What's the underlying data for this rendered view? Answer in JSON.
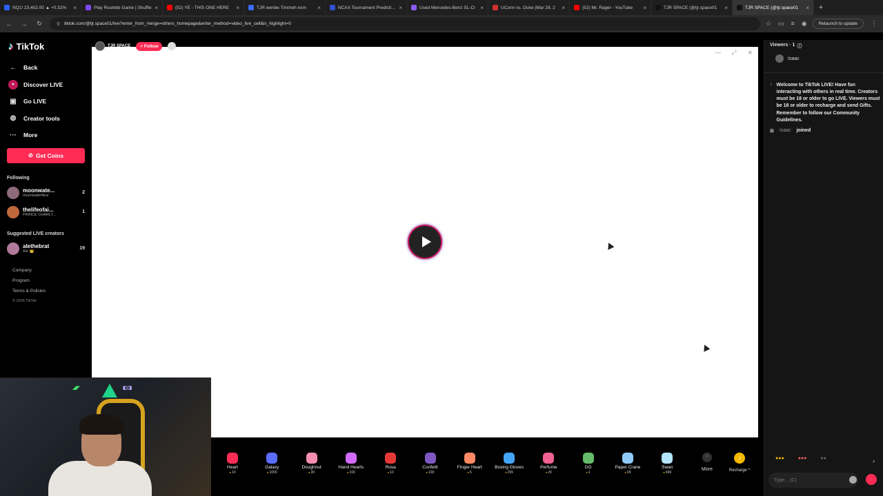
{
  "browser": {
    "tabs": [
      {
        "title": "NQ1! 23,402.00 ▲ +0.32%",
        "color": "#2962ff"
      },
      {
        "title": "Play Roulette Game | Shuffle",
        "color": "#7b4bff"
      },
      {
        "title": "(52) YE - THIS ONE HERE",
        "color": "#ff0000"
      },
      {
        "title": "TJR wenbe Timmeh esm",
        "color": "#3b6bff"
      },
      {
        "title": "NCAA Tournament Prediction",
        "color": "#3050d0"
      },
      {
        "title": "Used Mercedes-Benz SL-Cl",
        "color": "#8b5cf6"
      },
      {
        "title": "UConn vs. Duke (Mar 29, 2",
        "color": "#d32f2f"
      },
      {
        "title": "(52) Mr. Rager - YouTube",
        "color": "#ff0000"
      },
      {
        "title": "TJR SPACE (@tjr.space01",
        "color": "#111111"
      },
      {
        "title": "TJR SPACE (@tjr.space01",
        "color": "#111111"
      }
    ],
    "url": "tiktok.com/@tjr.space01/live?enter_from_merge=others_homepage&enter_method=video_live_cell&is_highlight=0",
    "relaunch": "Relaunch to update"
  },
  "sidebar": {
    "logo": "TikTok",
    "back": "Back",
    "nav": [
      "Discover LIVE",
      "Go LIVE",
      "Creator tools",
      "More"
    ],
    "get_coins": "Get Coins",
    "following_title": "Following",
    "following": [
      {
        "name": "moonwate...",
        "sub": "moonwaterfleur",
        "count": "2",
        "color": "#8e6a7a"
      },
      {
        "name": "thelifeofai...",
        "sub": "PRINCE CHARLT...",
        "count": "1",
        "color": "#c0683c"
      }
    ],
    "suggested_title": "Suggested LIVE creators",
    "suggested": [
      {
        "name": "alethebrat",
        "sub": "Ale 👑",
        "count": "19",
        "color": "#b07a9a"
      }
    ],
    "footer": [
      "Company",
      "Program",
      "Terms & Policies"
    ],
    "copyright": "© 2026 TikTok"
  },
  "stream": {
    "name": "TJR SPACE",
    "follow": "+ Follow"
  },
  "gifts": [
    {
      "name": "Heart",
      "price": "10",
      "color": "#ff2d55"
    },
    {
      "name": "Galaxy",
      "price": "1000",
      "color": "#5b6dff"
    },
    {
      "name": "Doughnut",
      "price": "30",
      "color": "#f48fb1"
    },
    {
      "name": "Hand Hearts",
      "price": "100",
      "color": "#d46bff"
    },
    {
      "name": "Rosa",
      "price": "10",
      "color": "#e53935"
    },
    {
      "name": "Confetti",
      "price": "100",
      "color": "#7e57c2"
    },
    {
      "name": "Finger Heart",
      "price": "5",
      "color": "#ff8a65"
    },
    {
      "name": "Boxing Gloves",
      "price": "299",
      "color": "#42a5f5"
    },
    {
      "name": "Perfume",
      "price": "20",
      "color": "#f06292"
    },
    {
      "name": "GG",
      "price": "1",
      "color": "#66bb6a"
    },
    {
      "name": "Paper Crane",
      "price": "99",
      "color": "#90caf9"
    },
    {
      "name": "Swan",
      "price": "699",
      "color": "#b3e5fc"
    }
  ],
  "gift_more": "More",
  "recharge": "Recharge ^",
  "panel": {
    "viewers": "Viewers · 1",
    "viewer_name": "Isaac",
    "welcome": "Welcome to TikTok LIVE! Have fun interacting with others in real time. Creators must be 18 or older to go LIVE. Viewers must be 18 or older to recharge and send Gifts. Remember to follow our Community Guidelines.",
    "joined_name": "Isaac",
    "joined_text": "joined",
    "chat_placeholder": "Type... (C)"
  }
}
